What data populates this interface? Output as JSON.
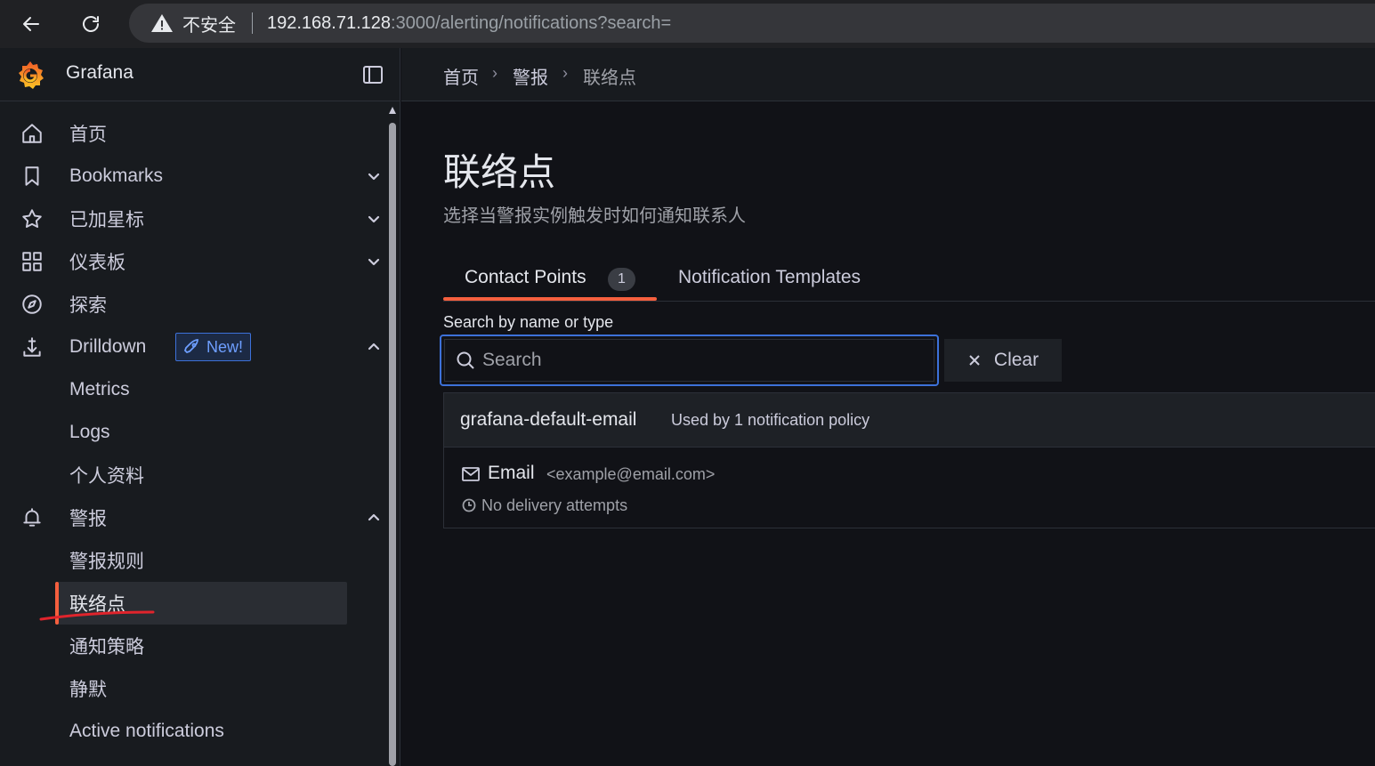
{
  "browser": {
    "insecure_label": "不安全",
    "url_host": "192.168.71.128",
    "url_path": ":3000/alerting/notifications?search="
  },
  "app": {
    "brand": "Grafana"
  },
  "sidebar": {
    "items": [
      {
        "label": "首页",
        "icon": "home-icon"
      },
      {
        "label": "Bookmarks",
        "icon": "bookmark-icon",
        "chevron": "down"
      },
      {
        "label": "已加星标",
        "icon": "star-icon",
        "chevron": "down"
      },
      {
        "label": "仪表板",
        "icon": "apps-icon",
        "chevron": "down"
      },
      {
        "label": "探索",
        "icon": "compass-icon"
      },
      {
        "label": "Drilldown",
        "icon": "drilldown-icon",
        "chevron": "up",
        "badge": "New!"
      },
      {
        "label": "Metrics"
      },
      {
        "label": "Logs"
      },
      {
        "label": "个人资料"
      },
      {
        "label": "警报",
        "icon": "bell-icon",
        "chevron": "up"
      },
      {
        "label": "警报规则"
      },
      {
        "label": "联络点",
        "active": true
      },
      {
        "label": "通知策略"
      },
      {
        "label": "静默"
      },
      {
        "label": "Active notifications"
      }
    ]
  },
  "breadcrumb": [
    "首页",
    "警报",
    "联络点"
  ],
  "page": {
    "title": "联络点",
    "subtitle": "选择当警报实例触发时如何通知联系人"
  },
  "tabs": {
    "contact_points": "Contact Points",
    "contact_points_count": "1",
    "templates": "Notification Templates"
  },
  "search": {
    "label": "Search by name or type",
    "placeholder": "Search",
    "value": "",
    "clear_label": "Clear"
  },
  "contact_points": [
    {
      "name": "grafana-default-email",
      "usage": "Used by 1 notification policy",
      "integration_type": "Email",
      "integration_address": "<example@email.com>",
      "delivery_status": "No delivery attempts"
    }
  ],
  "colors": {
    "accent": "#f55f3e",
    "focus": "#3d71d9",
    "background": "#111217"
  }
}
